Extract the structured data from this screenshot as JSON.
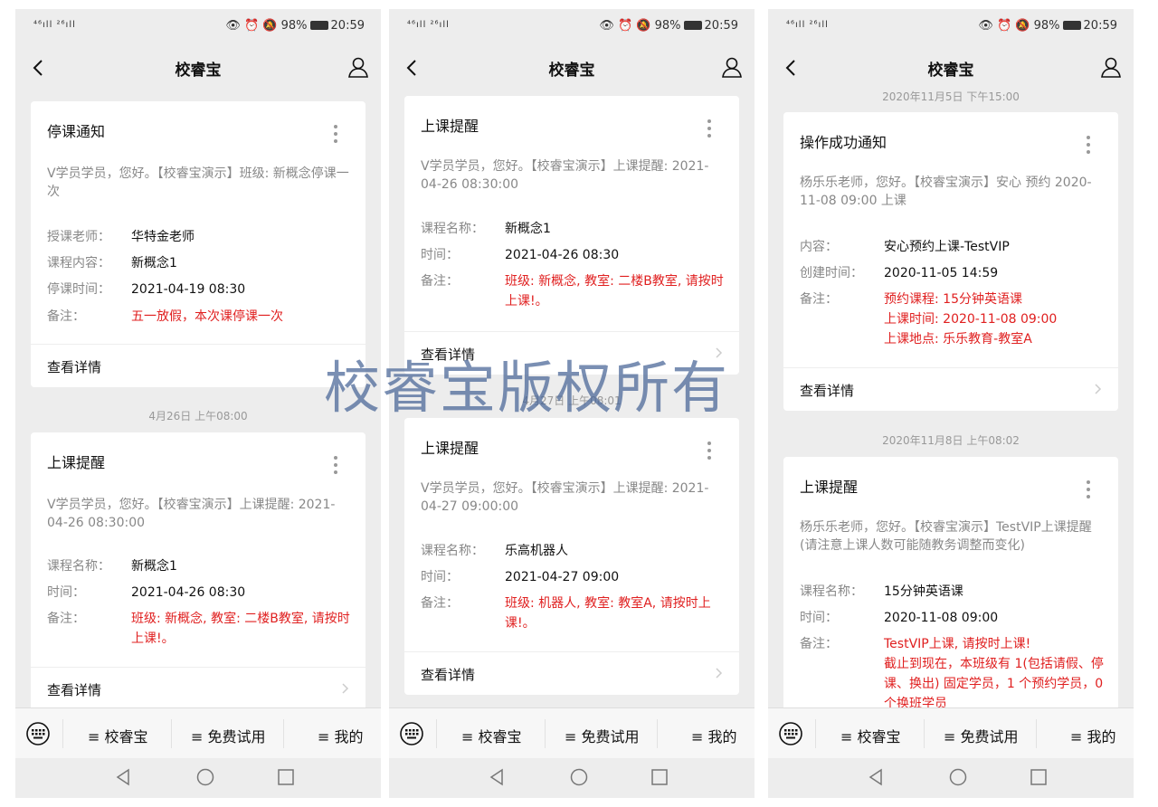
{
  "status": {
    "signal": "⁴⁶ıll ²⁶ıll ",
    "icons": "👁 ⏰ 🔕",
    "battery": "98%",
    "time": "20:59"
  },
  "nav": {
    "title": "校睿宝"
  },
  "menu": {
    "item1": "≡ 校睿宝",
    "item2": "≡ 免费试用",
    "item3": "≡ 我的"
  },
  "watermark": "校睿宝版权所有",
  "detail_label": "查看详情",
  "phones": [
    {
      "cards": [
        {
          "title": "停课通知",
          "desc": "V学员学员，您好。【校睿宝演示】班级: 新概念停课一次",
          "rows": [
            {
              "k": "授课老师：",
              "v": "华特金老师"
            },
            {
              "k": "课程内容：",
              "v": "新概念1"
            },
            {
              "k": "停课时间：",
              "v": "2021-04-19 08:30"
            },
            {
              "k": "备注：",
              "v": "五一放假，本次课停课一次"
            }
          ]
        },
        {
          "title": "上课提醒",
          "desc": "V学员学员，您好。【校睿宝演示】上课提醒: 2021-04-26 08:30:00",
          "rows": [
            {
              "k": "课程名称：",
              "v": "新概念1"
            },
            {
              "k": "时间：",
              "v": "2021-04-26 08:30"
            },
            {
              "k": "备注：",
              "v": "班级: 新概念, 教室: 二楼B教室, 请按时上课!。"
            }
          ]
        }
      ],
      "timestamps": [
        "4月26日 上午08:00"
      ]
    },
    {
      "cards": [
        {
          "title": "上课提醒",
          "desc": "V学员学员，您好。【校睿宝演示】上课提醒: 2021-04-26 08:30:00",
          "rows": [
            {
              "k": "课程名称：",
              "v": "新概念1"
            },
            {
              "k": "时间：",
              "v": "2021-04-26 08:30"
            },
            {
              "k": "备注：",
              "v": "班级: 新概念, 教室: 二楼B教室, 请按时上课!。"
            }
          ]
        },
        {
          "title": "上课提醒",
          "desc": "V学员学员，您好。【校睿宝演示】上课提醒: 2021-04-27 09:00:00",
          "rows": [
            {
              "k": "课程名称：",
              "v": "乐高机器人"
            },
            {
              "k": "时间：",
              "v": "2021-04-27 09:00"
            },
            {
              "k": "备注：",
              "v": "班级: 机器人, 教室: 教室A, 请按时上课!。"
            }
          ]
        }
      ],
      "timestamps": [
        "4月27日 上午08:01"
      ]
    },
    {
      "cards": [
        {
          "title": "操作成功通知",
          "desc": "杨乐乐老师，您好。【校睿宝演示】安心 预约 2020-11-08 09:00 上课",
          "rows": [
            {
              "k": "内容：",
              "v": "安心预约上课-TestVIP"
            },
            {
              "k": "创建时间：",
              "v": "2020-11-05 14:59"
            },
            {
              "k": "备注：",
              "v": "预约课程: 15分钟英语课"
            },
            {
              "k": "",
              "v": "上课时间: 2020-11-08 09:00"
            },
            {
              "k": "",
              "v": "上课地点: 乐乐教育-教室A"
            }
          ]
        },
        {
          "title": "上课提醒",
          "desc": "杨乐乐老师，您好。【校睿宝演示】TestVIP上课提醒(请注意上课人数可能随教务调整而变化)",
          "rows": [
            {
              "k": "课程名称：",
              "v": "15分钟英语课"
            },
            {
              "k": "时间：",
              "v": "2020-11-08 09:00"
            },
            {
              "k": "备注：",
              "v": "TestVIP上课, 请按时上课!"
            },
            {
              "k": "",
              "v": "截止到现在，本班级有 1(包括请假、停课、换出) 固定学员，1 个预约学员，0 个换班学员"
            }
          ]
        }
      ],
      "timestamps": [
        "2020年11月5日 下午15:00",
        "2020年11月8日 上午08:02"
      ]
    }
  ],
  "colors": {
    "accent_red": "#e02020",
    "bg": "#ededed",
    "watermark": "#4a6a99"
  },
  "icons": [
    "back-icon",
    "user-icon",
    "more-icon",
    "chevron-right-icon",
    "keyboard-icon",
    "back-triangle-icon",
    "home-circle-icon",
    "recent-square-icon"
  ]
}
